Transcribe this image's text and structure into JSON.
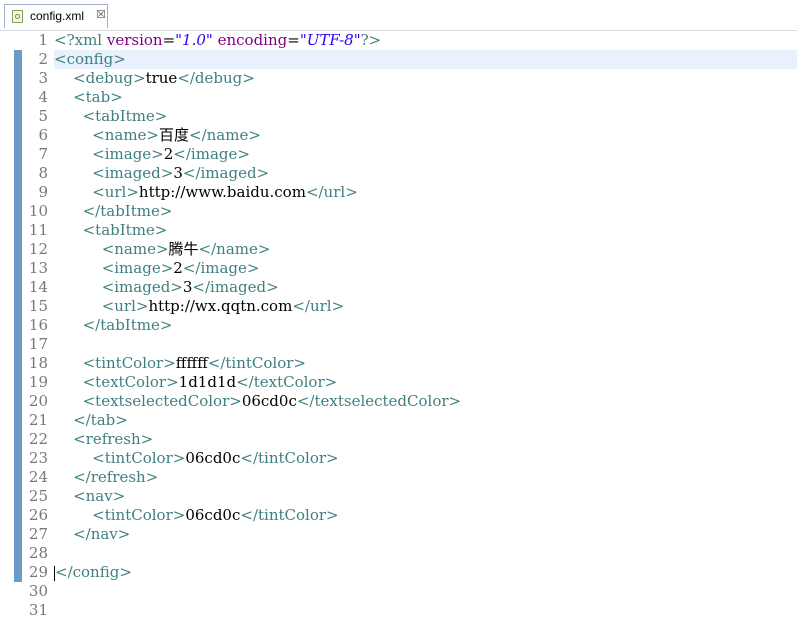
{
  "tab": {
    "label": "config.xml",
    "close_glyph": "☒",
    "file_icon": "xml-file-icon"
  },
  "editor": {
    "highlighted_line": 2,
    "marker_lines_start": 2,
    "marker_lines_end": 29,
    "lines": [
      {
        "n": "1",
        "tokens": [
          [
            "tag",
            "<?xml "
          ],
          [
            "attr",
            "version"
          ],
          [
            "txt",
            "="
          ],
          [
            "val",
            "\"1.0\""
          ],
          [
            "txt",
            " "
          ],
          [
            "attr",
            "encoding"
          ],
          [
            "txt",
            "="
          ],
          [
            "val",
            "\"UTF-8\""
          ],
          [
            "tag",
            "?>"
          ]
        ]
      },
      {
        "n": "2",
        "tokens": [
          [
            "tag",
            "<config>"
          ]
        ]
      },
      {
        "n": "3",
        "tokens": [
          [
            "txt",
            "    "
          ],
          [
            "tag",
            "<debug>"
          ],
          [
            "txt",
            "true"
          ],
          [
            "tag",
            "</debug>"
          ]
        ]
      },
      {
        "n": "4",
        "tokens": [
          [
            "txt",
            "    "
          ],
          [
            "tag",
            "<tab>"
          ]
        ]
      },
      {
        "n": "5",
        "tokens": [
          [
            "txt",
            "      "
          ],
          [
            "tag",
            "<tabItme>"
          ]
        ]
      },
      {
        "n": "6",
        "tokens": [
          [
            "txt",
            "        "
          ],
          [
            "tag",
            "<name>"
          ],
          [
            "txt",
            "百度"
          ],
          [
            "tag",
            "</name>"
          ]
        ]
      },
      {
        "n": "7",
        "tokens": [
          [
            "txt",
            "        "
          ],
          [
            "tag",
            "<image>"
          ],
          [
            "txt",
            "2"
          ],
          [
            "tag",
            "</image>"
          ]
        ]
      },
      {
        "n": "8",
        "tokens": [
          [
            "txt",
            "        "
          ],
          [
            "tag",
            "<imaged>"
          ],
          [
            "txt",
            "3"
          ],
          [
            "tag",
            "</imaged>"
          ]
        ]
      },
      {
        "n": "9",
        "tokens": [
          [
            "txt",
            "        "
          ],
          [
            "tag",
            "<url>"
          ],
          [
            "txt",
            "http://www.baidu.com"
          ],
          [
            "tag",
            "</url>"
          ]
        ]
      },
      {
        "n": "10",
        "tokens": [
          [
            "txt",
            "      "
          ],
          [
            "tag",
            "</tabItme>"
          ]
        ]
      },
      {
        "n": "11",
        "tokens": [
          [
            "txt",
            "      "
          ],
          [
            "tag",
            "<tabItme>"
          ]
        ]
      },
      {
        "n": "12",
        "tokens": [
          [
            "txt",
            "          "
          ],
          [
            "tag",
            "<name>"
          ],
          [
            "txt",
            "腾牛"
          ],
          [
            "tag",
            "</name>"
          ]
        ]
      },
      {
        "n": "13",
        "tokens": [
          [
            "txt",
            "          "
          ],
          [
            "tag",
            "<image>"
          ],
          [
            "txt",
            "2"
          ],
          [
            "tag",
            "</image>"
          ]
        ]
      },
      {
        "n": "14",
        "tokens": [
          [
            "txt",
            "          "
          ],
          [
            "tag",
            "<imaged>"
          ],
          [
            "txt",
            "3"
          ],
          [
            "tag",
            "</imaged>"
          ]
        ]
      },
      {
        "n": "15",
        "tokens": [
          [
            "txt",
            "          "
          ],
          [
            "tag",
            "<url>"
          ],
          [
            "txt",
            "http://wx.qqtn.com"
          ],
          [
            "tag",
            "</url>"
          ]
        ]
      },
      {
        "n": "16",
        "tokens": [
          [
            "txt",
            "      "
          ],
          [
            "tag",
            "</tabItme>"
          ]
        ]
      },
      {
        "n": "17",
        "tokens": []
      },
      {
        "n": "18",
        "tokens": [
          [
            "txt",
            "      "
          ],
          [
            "tag",
            "<tintColor>"
          ],
          [
            "txt",
            "ffffff"
          ],
          [
            "tag",
            "</tintColor>"
          ]
        ]
      },
      {
        "n": "19",
        "tokens": [
          [
            "txt",
            "      "
          ],
          [
            "tag",
            "<textColor>"
          ],
          [
            "txt",
            "1d1d1d"
          ],
          [
            "tag",
            "</textColor>"
          ]
        ]
      },
      {
        "n": "20",
        "tokens": [
          [
            "txt",
            "      "
          ],
          [
            "tag",
            "<textselectedColor>"
          ],
          [
            "txt",
            "06cd0c"
          ],
          [
            "tag",
            "</textselectedColor>"
          ]
        ]
      },
      {
        "n": "21",
        "tokens": [
          [
            "txt",
            "    "
          ],
          [
            "tag",
            "</tab>"
          ]
        ]
      },
      {
        "n": "22",
        "tokens": [
          [
            "txt",
            "    "
          ],
          [
            "tag",
            "<refresh>"
          ]
        ]
      },
      {
        "n": "23",
        "tokens": [
          [
            "txt",
            "        "
          ],
          [
            "tag",
            "<tintColor>"
          ],
          [
            "txt",
            "06cd0c"
          ],
          [
            "tag",
            "</tintColor>"
          ]
        ]
      },
      {
        "n": "24",
        "tokens": [
          [
            "txt",
            "    "
          ],
          [
            "tag",
            "</refresh>"
          ]
        ]
      },
      {
        "n": "25",
        "tokens": [
          [
            "txt",
            "    "
          ],
          [
            "tag",
            "<nav>"
          ]
        ]
      },
      {
        "n": "26",
        "tokens": [
          [
            "txt",
            "        "
          ],
          [
            "tag",
            "<tintColor>"
          ],
          [
            "txt",
            "06cd0c"
          ],
          [
            "tag",
            "</tintColor>"
          ]
        ]
      },
      {
        "n": "27",
        "tokens": [
          [
            "txt",
            "    "
          ],
          [
            "tag",
            "</nav>"
          ]
        ]
      },
      {
        "n": "28",
        "tokens": []
      },
      {
        "n": "29",
        "tokens": [
          [
            "caret",
            ""
          ],
          [
            "tag",
            "</config>"
          ]
        ]
      },
      {
        "n": "30",
        "tokens": []
      },
      {
        "n": "31",
        "tokens": []
      }
    ]
  },
  "colors": {
    "tag": "#3f7f7f",
    "attribute": "#7f007f",
    "value": "#2a00ff",
    "text": "#000000",
    "line_number": "#787878",
    "current_line": "#e8f2fe",
    "gutter_marker": "#6d99c6"
  }
}
